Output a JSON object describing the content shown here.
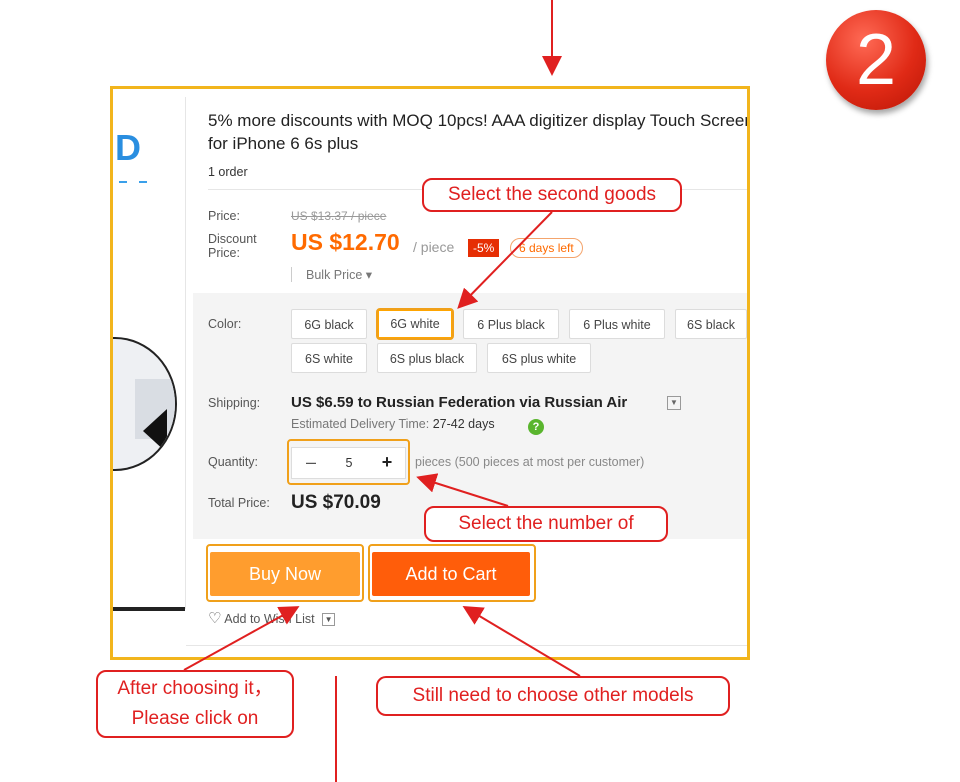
{
  "step_number": "2",
  "product": {
    "title": "5% more discounts with MOQ 10pcs! AAA digitizer display Touch Screen for iPhone 6 6s plus",
    "orders": "1 order",
    "price_label": "Price:",
    "old_price": "US $13.37 / piece",
    "discount_label": "Discount Price:",
    "discount_price": "US $12.70",
    "per_piece": "/ piece",
    "discount_tag": "-5%",
    "days_left": "6 days left",
    "bulk_price": "Bulk Price ▾",
    "color_label": "Color:",
    "colors": [
      "6G black",
      "6G white",
      "6 Plus black",
      "6 Plus white",
      "6S black",
      "6S white",
      "6S plus black",
      "6S plus white"
    ],
    "selected_color": "6G white",
    "shipping_label": "Shipping:",
    "shipping_text": "US $6.59 to Russian Federation via Russian Air",
    "est_label": "Estimated Delivery Time:",
    "est_value": "27-42 days",
    "quantity_label": "Quantity:",
    "quantity_value": "5",
    "quantity_minus": "–",
    "quantity_plus": "+",
    "quantity_note": "pieces (500 pieces at most per customer)",
    "total_label": "Total Price:",
    "total_price": "US $70.09",
    "buy_now": "Buy Now",
    "add_to_cart": "Add to Cart",
    "wish_list": "Add to Wish List"
  },
  "annotations": {
    "select_goods": "Select the second goods",
    "select_number": "Select the number of",
    "after_choosing_line1": "After choosing it，",
    "after_choosing_line2": "Please click on",
    "other_models": "Still need to choose other models"
  },
  "colors_theme": {
    "orange_price": "#ff6a00",
    "buy_now_bg": "#ff9d2e",
    "cart_bg": "#ff5d0a",
    "annotation_red": "#e02020",
    "highlight_yellow": "#f2b51c"
  }
}
